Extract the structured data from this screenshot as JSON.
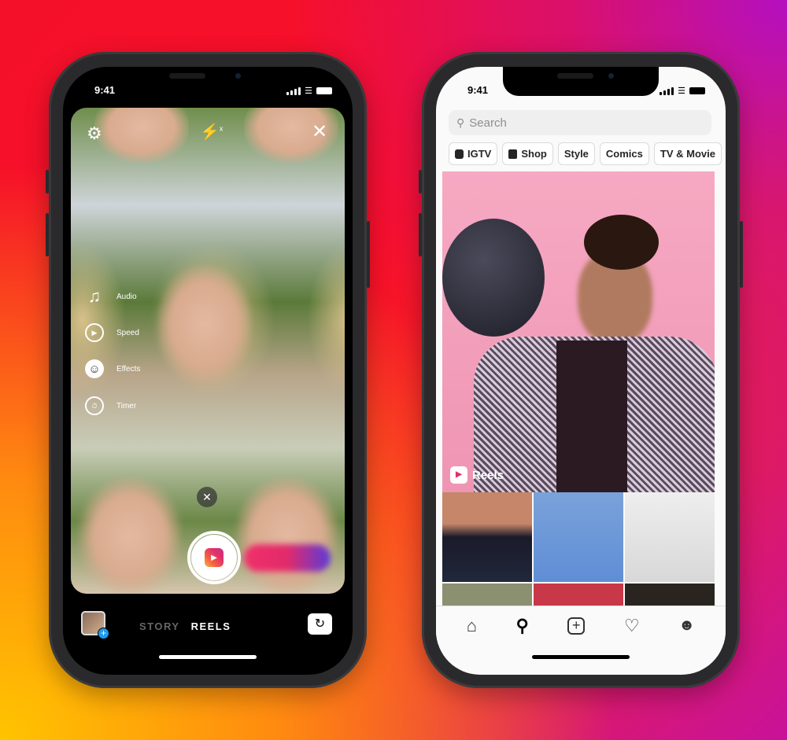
{
  "left_phone": {
    "status_time": "9:41",
    "top_icons": [
      "settings-icon",
      "flash-off-icon",
      "close-icon"
    ],
    "tools": [
      {
        "label": "Audio",
        "icon": "music-note-icon"
      },
      {
        "label": "Speed",
        "icon": "speed-icon"
      },
      {
        "label": "Effects",
        "icon": "effects-face-icon"
      },
      {
        "label": "Timer",
        "icon": "timer-icon"
      }
    ],
    "modes": {
      "story": "STORY",
      "reels": "REELS",
      "active": "REELS"
    },
    "reels_gradient": [
      "#fcaf45",
      "#e1306c",
      "#c13584"
    ]
  },
  "right_phone": {
    "status_time": "9:41",
    "search": {
      "placeholder": "Search"
    },
    "chips": [
      {
        "label": "IGTV",
        "icon": "igtv-icon"
      },
      {
        "label": "Shop",
        "icon": "shopping-bag-icon"
      },
      {
        "label": "Style"
      },
      {
        "label": "Comics"
      },
      {
        "label": "TV & Movie"
      }
    ],
    "hero_label": "Reels",
    "nav": [
      "home-icon",
      "search-icon",
      "new-post-icon",
      "heart-icon",
      "profile-icon"
    ],
    "active_nav": "search-icon"
  }
}
